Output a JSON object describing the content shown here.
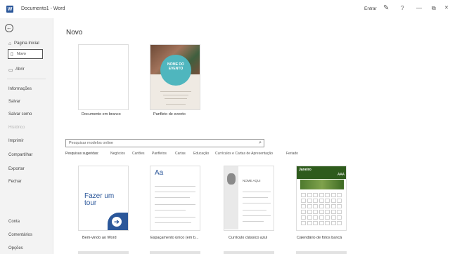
{
  "window": {
    "title": "Documento1 - Word",
    "app_icon": "W",
    "signin": "Entrar",
    "icons": [
      "help-icon",
      "minimize-icon",
      "restore-icon",
      "close-icon"
    ],
    "help_glyph": "?",
    "min_glyph": "—",
    "restore_glyph": "⧉",
    "close_glyph": "✕",
    "pen_glyph": "✎"
  },
  "sidebar": {
    "back_glyph": "←",
    "items": [
      {
        "label": "Página Inicial",
        "icon": "home-icon"
      },
      {
        "label": "Novo",
        "icon": "new-document-icon",
        "selected": true
      },
      {
        "label": "Abrir",
        "icon": "open-folder-icon"
      }
    ],
    "middle": [
      "Informações",
      "Salvar",
      "Salvar como",
      "Histórico",
      "Imprimir",
      "Compartilhar",
      "Exportar",
      "Fechar"
    ],
    "bottom": [
      "Conta",
      "Comentários",
      "Opções"
    ]
  },
  "content": {
    "heading": "Novo",
    "blank_label": "Documento em branco",
    "flyer_label": "Panfleto de evento",
    "flyer_title": "NOME DO EVENTO",
    "search_placeholder": "Pesquisar modelos online",
    "suggest_label": "Pesquisas sugeridas:",
    "suggestions": [
      "Negócios",
      "Cartões",
      "Panfletos",
      "Cartas",
      "Educação",
      "Currículos e Cartas de Apresentação",
      "Feriado"
    ],
    "templates": [
      {
        "label": "Bem-vindo ao Word",
        "text": "Fazer um tour"
      },
      {
        "label": "Espaçamento único (em b...",
        "text": "Aa"
      },
      {
        "label": "Currículo clássico azul",
        "text": "NOME AQUI"
      },
      {
        "label": "Calendário de fotos bancá",
        "text": "Janeiro",
        "year": "AAA"
      }
    ]
  },
  "colors": {
    "accent": "#2b579a",
    "sidebar_bg": "#f3f3f3",
    "calendar_green": "#2e5b1c",
    "flyer_teal": "#4fb6be"
  }
}
